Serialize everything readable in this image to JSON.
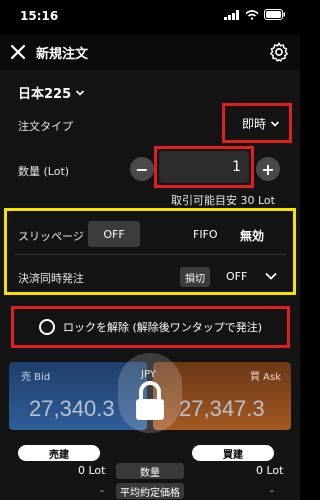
{
  "status": {
    "time": "15:16"
  },
  "nav": {
    "title": "新規注文"
  },
  "symbol": "日本225",
  "order_type": {
    "label": "注文タイプ",
    "value": "即時"
  },
  "quantity": {
    "label": "数量 (Lot)",
    "value": "1",
    "minus": "−",
    "plus": "+",
    "hint": "取引可能目安 30 Lot"
  },
  "slippage": {
    "label": "スリッページ",
    "value": "OFF",
    "fifo_label": "FIFO",
    "fifo_value": "無効"
  },
  "settle": {
    "label": "決済同時発注",
    "cut": "損切",
    "value": "OFF"
  },
  "unlock": {
    "label": "ロックを解除 (解除後ワンタップで発注)"
  },
  "prices": {
    "bid_label": "売 Bid",
    "bid": "27,340.3",
    "ask_label": "買 Ask",
    "ask": "27,347.3",
    "currency": "JPY"
  },
  "positions": {
    "sell_label": "売建",
    "buy_label": "買建",
    "sell_lot": "0 Lot",
    "buy_lot": "0 Lot",
    "qty_label": "数量",
    "avg_label": "平均約定価格",
    "sell_avg": "-",
    "buy_avg": "-"
  },
  "colors": {
    "highlight_red": "#e02020",
    "highlight_yellow": "#f4e400",
    "bid": "#2f5e9a",
    "ask": "#a55a23"
  }
}
